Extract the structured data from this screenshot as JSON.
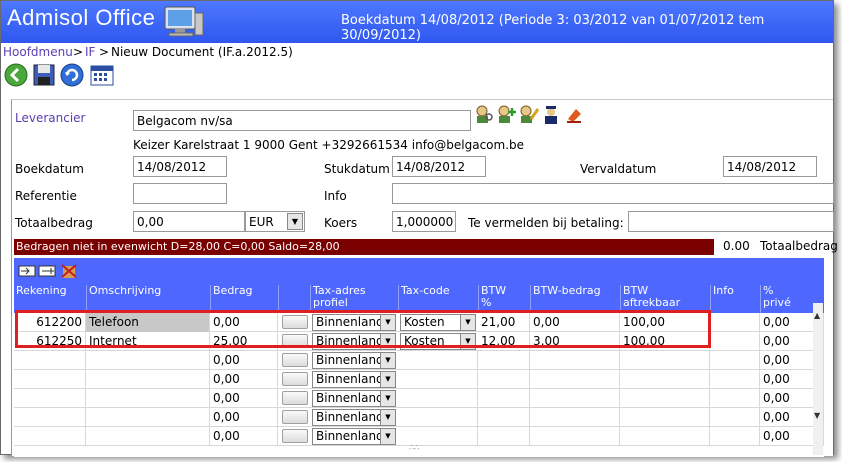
{
  "app": {
    "title": "Admisol Office",
    "boek_info": "Boekdatum 14/08/2012 (Periode 3: 03/2012 van 01/07/2012 tem 30/09/2012)"
  },
  "breadcrumb": {
    "home": "Hoofdmenu",
    "sep1": ">",
    "section": "IF",
    "sep2": ">",
    "current": "Nieuw Document (IF.a.2012.5)"
  },
  "toolbar": {
    "icons": [
      "back-icon",
      "save-icon",
      "refresh-icon",
      "calendar-icon"
    ]
  },
  "form": {
    "leverancier_label": "Leverancier",
    "leverancier_value": "Belgacom nv/sa",
    "leverancier_address": "Keizer Karelstraat 1 9000 Gent +3292661534 info@belgacom.be",
    "boekdatum_label": "Boekdatum",
    "boekdatum_value": "14/08/2012",
    "stukdatum_label": "Stukdatum",
    "stukdatum_value": "14/08/2012",
    "vervaldatum_label": "Vervaldatum",
    "vervaldatum_value": "14/08/2012",
    "referentie_label": "Referentie",
    "referentie_value": "",
    "info_label": "Info",
    "info_value": "",
    "totaalbedrag_label": "Totaalbedrag",
    "totaalbedrag_value": "0,00",
    "currency_value": "EUR",
    "koers_label": "Koers",
    "koers_value": "1,000000",
    "vermelden_label": "Te vermelden bij betaling:",
    "vermelden_value": ""
  },
  "status": {
    "warning": "Bedragen niet in evenwicht D=28,00 C=0,00 Saldo=28,00",
    "total_value": "0.00",
    "total_label": "Totaalbedrag"
  },
  "grid": {
    "headers": {
      "rekening": "Rekening",
      "omschrijving": "Omschrijving",
      "bedrag": "Bedrag",
      "taxadres_1": "Tax-adres",
      "taxadres_2": "profiel",
      "taxcode": "Tax-code",
      "btw_1": "BTW",
      "btw_2": "%",
      "btwbedrag": "BTW-bedrag",
      "btwaftrek_1": "BTW",
      "btwaftrek_2": "aftrekbaar",
      "info": "Info",
      "prive_1": "%",
      "prive_2": "privé"
    },
    "rows": [
      {
        "rekening": "612200",
        "omschrijving": "Telefoon",
        "bedrag": "0,00",
        "taxadres": "Binnenland",
        "taxcode": "Kosten",
        "btw": "21,00",
        "btwbedrag": "0,00",
        "aftrek": "100,00",
        "prive": "0,00"
      },
      {
        "rekening": "612250",
        "omschrijving": "Internet",
        "bedrag": "25,00",
        "taxadres": "Binnenland",
        "taxcode": "Kosten",
        "btw": "12,00",
        "btwbedrag": "3,00",
        "aftrek": "100,00",
        "prive": "0,00"
      },
      {
        "rekening": "",
        "omschrijving": "",
        "bedrag": "0,00",
        "taxadres": "Binnenland",
        "taxcode": "",
        "btw": "",
        "btwbedrag": "",
        "aftrek": "",
        "prive": "0,00"
      },
      {
        "rekening": "",
        "omschrijving": "",
        "bedrag": "0,00",
        "taxadres": "Binnenland",
        "taxcode": "",
        "btw": "",
        "btwbedrag": "",
        "aftrek": "",
        "prive": "0,00"
      },
      {
        "rekening": "",
        "omschrijving": "",
        "bedrag": "0,00",
        "taxadres": "Binnenland",
        "taxcode": "",
        "btw": "",
        "btwbedrag": "",
        "aftrek": "",
        "prive": "0,00"
      },
      {
        "rekening": "",
        "omschrijving": "",
        "bedrag": "0,00",
        "taxadres": "Binnenland",
        "taxcode": "",
        "btw": "",
        "btwbedrag": "",
        "aftrek": "",
        "prive": "0,00"
      },
      {
        "rekening": "",
        "omschrijving": "",
        "bedrag": "0,00",
        "taxadres": "Binnenland",
        "taxcode": "",
        "btw": "",
        "btwbedrag": "",
        "aftrek": "",
        "prive": "0,00"
      }
    ]
  },
  "colors": {
    "titlebar": "#3a63f5",
    "grid_header": "#4d67ff",
    "warning_bg": "#7a0000",
    "highlight": "#e02020"
  }
}
